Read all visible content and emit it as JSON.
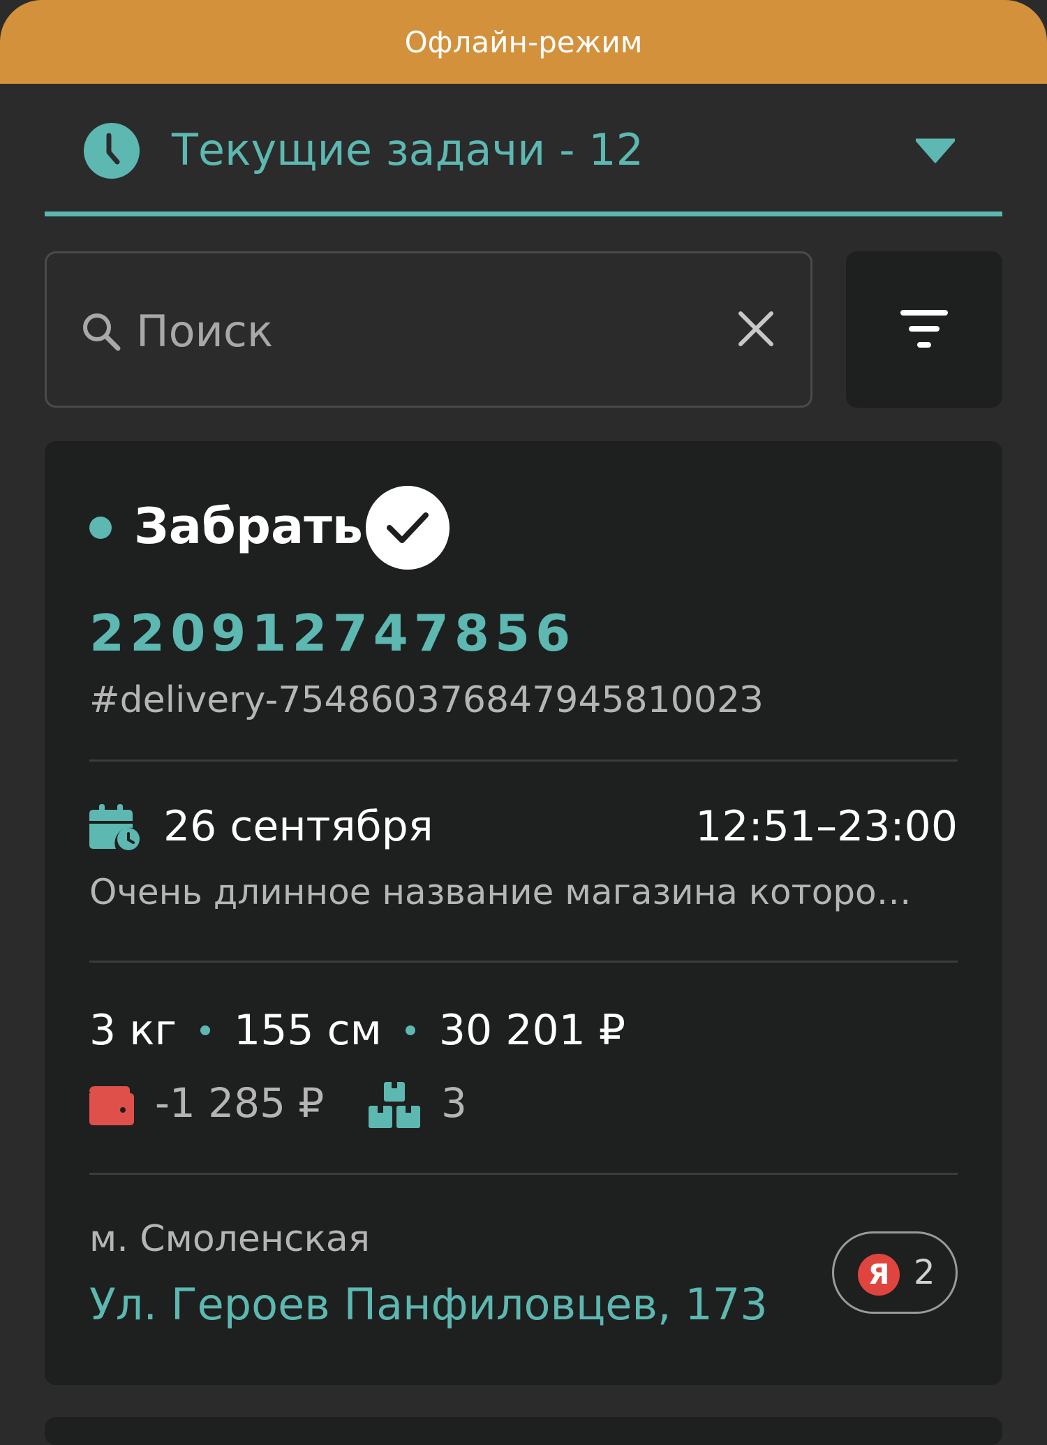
{
  "offline_banner": {
    "text": "Офлайн-режим",
    "color": "#d4913b"
  },
  "header": {
    "title": "Текущие задачи - 12",
    "icon": "clock-icon",
    "dropdown_icon": "caret-down-icon",
    "accent_color": "#5cb8b1"
  },
  "search": {
    "placeholder": "Поиск",
    "value": "",
    "icon": "search-icon",
    "clear_icon": "close-icon"
  },
  "filter": {
    "icon": "filter-icon"
  },
  "task_card": {
    "status": "Забрать",
    "status_icon": "check-icon",
    "order_number": "220912747856",
    "delivery_id": "#delivery-75486037684794581002З",
    "date": "26 сентября",
    "time_window": "12:51–23:00",
    "store_name": "Очень длинное название магазина которо…",
    "weight": "3 кг",
    "dimensions": "155 см",
    "price": "30 201 ₽",
    "cod_amount": "-1 285 ₽",
    "cod_icon": "wallet-icon",
    "cod_color": "#e0504a",
    "places_count": "3",
    "places_icon": "boxes-icon",
    "metro": "м. Смоленская",
    "address": "Ул. Героев Панфиловцев, 173",
    "provider": {
      "icon_letter": "Я",
      "count": "2",
      "icon_color": "#e0443e"
    }
  }
}
